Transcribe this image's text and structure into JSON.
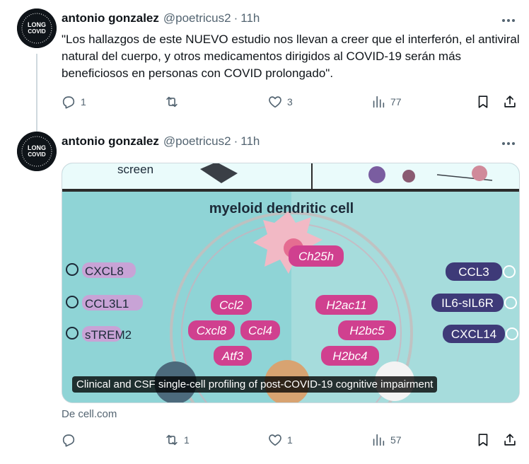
{
  "tweets": [
    {
      "author_name": "antonio gonzalez",
      "handle": "@poetricus2",
      "separator": "·",
      "time": "11h",
      "text": "\"Los hallazgos de este NUEVO estudio nos llevan a creer que el interferón, el antiviral natural del cuerpo, y otros medicamentos dirigidos al COVID-19 serán más beneficiosos en personas con COVID prolongado\".",
      "counts": {
        "reply": "1",
        "retweet": "",
        "like": "3",
        "views": "77"
      }
    },
    {
      "author_name": "antonio gonzalez",
      "handle": "@poetricus2",
      "separator": "·",
      "time": "11h",
      "counts": {
        "reply": "",
        "retweet": "1",
        "like": "1",
        "views": "57"
      },
      "card": {
        "caption": "Clinical and CSF single-cell profiling of post-COVID-19 cognitive impairment",
        "source": "De cell.com",
        "figure": {
          "top_left_label": "screen",
          "title": "myeloid dendritic cell",
          "center_label": "Ch25h",
          "left_receptors": [
            "CXCL8",
            "CCL3L1",
            "sTREM2"
          ],
          "right_receptors": [
            "CCL3",
            "IL6-sIL6R",
            "CXCL14"
          ],
          "inner_left_genes": [
            "Ccl2",
            "Cxcl8",
            "Ccl4",
            "Atf3"
          ],
          "inner_right_genes": [
            "H2ac11",
            "H2bc5",
            "H2bc4"
          ]
        }
      }
    }
  ],
  "avatar": {
    "line1": "LONG",
    "line2": "COVID"
  },
  "colors": {
    "muted": "#536471",
    "text": "#0f1419",
    "border": "#cfd9de",
    "gene_pill": "#d0408f",
    "receptor_purple": "#3e3a78"
  }
}
